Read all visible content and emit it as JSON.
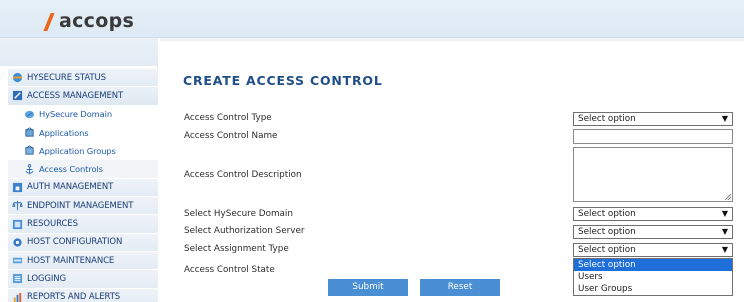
{
  "brand": {
    "logo_text": "accops",
    "accent": "#e8691b"
  },
  "sidebar": {
    "items": [
      {
        "label": "HYSECURE STATUS",
        "icon": "status-icon",
        "sub": false
      },
      {
        "label": "ACCESS MANAGEMENT",
        "icon": "access-management-icon",
        "sub": false,
        "open": true
      },
      {
        "label": "HySecure Domain",
        "icon": "domain-icon",
        "sub": true
      },
      {
        "label": "Applications",
        "icon": "applications-icon",
        "sub": true
      },
      {
        "label": "Application Groups",
        "icon": "application-groups-icon",
        "sub": true
      },
      {
        "label": "Access Controls",
        "icon": "anchor-icon",
        "sub": true,
        "active": true
      },
      {
        "label": "AUTH MANAGEMENT",
        "icon": "auth-icon",
        "sub": false
      },
      {
        "label": "ENDPOINT MANAGEMENT",
        "icon": "endpoint-icon",
        "sub": false
      },
      {
        "label": "RESOURCES",
        "icon": "resources-icon",
        "sub": false
      },
      {
        "label": "HOST CONFIGURATION",
        "icon": "host-config-icon",
        "sub": false
      },
      {
        "label": "HOST MAINTENANCE",
        "icon": "host-maintenance-icon",
        "sub": false
      },
      {
        "label": "LOGGING",
        "icon": "logging-icon",
        "sub": false
      },
      {
        "label": "REPORTS AND ALERTS",
        "icon": "reports-icon",
        "sub": false
      }
    ]
  },
  "form": {
    "title": "CREATE ACCESS CONTROL",
    "labels": {
      "type": "Access Control Type",
      "name": "Access Control Name",
      "description": "Access Control Description",
      "domain": "Select HySecure Domain",
      "auth_server": "Select Authorization Server",
      "assignment": "Select Assignment Type",
      "state": "Access Control State"
    },
    "values": {
      "type": "Select option",
      "domain": "Select option",
      "auth_server": "Select option",
      "assignment": "Select option"
    },
    "assignment_options": [
      "Select option",
      "Users",
      "User Groups"
    ],
    "submit_label": "Submit",
    "reset_label": "Reset"
  }
}
